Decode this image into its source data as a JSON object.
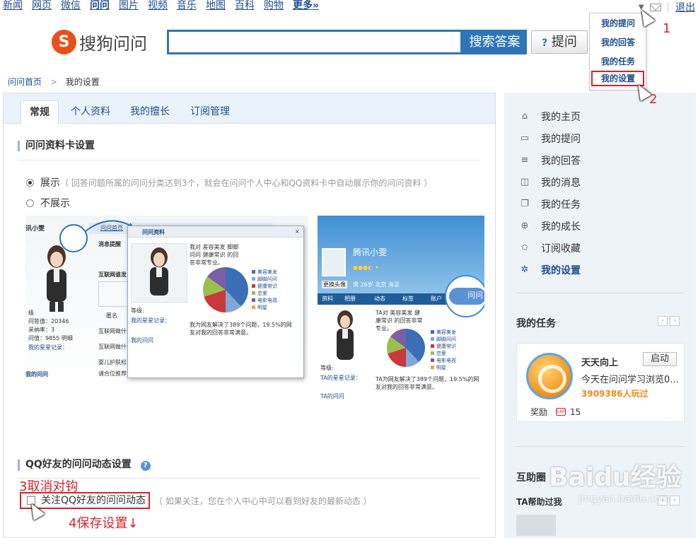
{
  "topnav": {
    "links": [
      "新闻",
      "网页",
      "微信",
      "问问",
      "图片",
      "视频",
      "音乐",
      "地图",
      "百科",
      "购物",
      "更多»"
    ],
    "active": "问问",
    "logout": "退出"
  },
  "dropdown": {
    "items": [
      "我的提问",
      "我的回答",
      "我的任务",
      "我的设置"
    ],
    "selected": "我的设置"
  },
  "header": {
    "logo_letter": "S",
    "logo_text": "搜狗问问",
    "search_value": "",
    "search_button": "搜索答案",
    "ask_icon": "?",
    "ask_button": "提问"
  },
  "breadcrumb": {
    "home": "问问首页",
    "sep": ">",
    "current": "我的设置"
  },
  "tabs": [
    "常规",
    "个人资料",
    "我的擅长",
    "订阅管理"
  ],
  "active_tab": "常规",
  "section1": {
    "title": "问问资料卡设置",
    "option_show": "展示",
    "option_show_hint": "（ 回答问题所属的问问分类达到3个，就会在问问个人中心和QQ资料卡中自动展示你的问问资料 ）",
    "option_hide": "不展示",
    "preview1": {
      "user_name": "讯小雯",
      "tab_home": "问问首页",
      "win_title": "问问资料",
      "msg_label": "消息提醒",
      "q_title": "互联网谁发",
      "anon_label": "匿名",
      "stats": [
        "级",
        "问答值：20346",
        "采纳率：3",
        "问值：9855 明细"
      ],
      "honor_label": "我的星星记录：",
      "my_wenwen": "我的问问",
      "q_lines": [
        "互联网做什么",
        "互联网做什么",
        "婴儿护肤松",
        "请合位推荐乡"
      ],
      "card_text": "我对 差容美发 脚脚问问 健康常识 的回答非常专业。",
      "level_label": "等级:",
      "stars_label": "我的星星记录：",
      "help_text": "我为网友解决了389个问题，19.5%的网友对我的回答非常满意。",
      "my_link": "我的问问",
      "legend": [
        "美容美发",
        "脚脚问问",
        "健康常识",
        "恋爱",
        "电影电视",
        "明星"
      ]
    },
    "preview2": {
      "name": "腾讯小雯",
      "change_avatar": "更换头像",
      "profile_line": "男  26岁  北京 海淀",
      "tabs": [
        "资料",
        "相册",
        "动态",
        "标签",
        "账户"
      ],
      "badge_label": "问问",
      "card_text": "TA对 美容美发 健康常识 的回答非常专业。",
      "level_label": "等级:",
      "stars_label": "TA的星星记录：",
      "help_text": "TA为网友解决了389个问题，19.5%的网友对我的回答非常满意。",
      "ta_link": "TA的问问"
    }
  },
  "section2": {
    "title": "QQ好友的问问动态设置",
    "help_icon": "?",
    "checkbox_label": "关注QQ好友的问问动态",
    "checkbox_hint": "（ 如果关注，您在个人中心中可以看到好友的最新动态 ）"
  },
  "annotations": {
    "a1": "1",
    "a2": "2",
    "a3": "3取消对钩",
    "a4": "4保存设置↓"
  },
  "sidebar": {
    "items": [
      {
        "label": "我的主页",
        "icon": "home-icon"
      },
      {
        "label": "我的提问",
        "icon": "question-bubble-icon"
      },
      {
        "label": "我的回答",
        "icon": "answer-bubble-icon"
      },
      {
        "label": "我的消息",
        "icon": "message-icon"
      },
      {
        "label": "我的任务",
        "icon": "task-icon"
      },
      {
        "label": "我的成长",
        "icon": "growth-icon"
      },
      {
        "label": "订阅收藏",
        "icon": "star-icon"
      },
      {
        "label": "我的设置",
        "icon": "gear-icon"
      }
    ],
    "active": "我的设置",
    "tasks_title": "我的任务",
    "task": {
      "name": "天天向上",
      "start_button": "启动",
      "desc": "今天在问问学习浏览0...",
      "count": "3909386人玩过",
      "reward_label": "奖励",
      "exp_badge": "EXP",
      "reward_value": "15"
    },
    "help_title": "互助圈",
    "help_sub": "TA帮助过我"
  },
  "watermark": {
    "text": "Baidu经验",
    "sub": "jingyan.baidu.com"
  },
  "colors": {
    "accent": "#2e75b6",
    "link": "#1f4d8f",
    "highlight": "#d9222a",
    "sidebar_bg": "#eef3f8"
  }
}
